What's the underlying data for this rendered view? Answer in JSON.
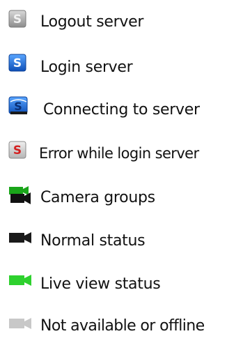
{
  "legend": {
    "items": [
      {
        "icon": "server-logout-icon",
        "label": "Logout server",
        "color": "#9a9a9a"
      },
      {
        "icon": "server-login-icon",
        "label": "Login server",
        "color": "#1c6fd6"
      },
      {
        "icon": "server-connecting-icon",
        "label": "Connecting to server",
        "color": "#1c6fd6"
      },
      {
        "icon": "server-error-icon",
        "label": "Error while login server",
        "color": "#d42020"
      },
      {
        "icon": "camera-groups-icon",
        "label": "Camera groups",
        "color": "#1aa51a"
      },
      {
        "icon": "camera-normal-icon",
        "label": "Normal status",
        "color": "#1a1a1a"
      },
      {
        "icon": "camera-live-icon",
        "label": "Live view status",
        "color": "#2ed12e"
      },
      {
        "icon": "camera-offline-icon",
        "label": "Not available or offline",
        "color": "#c8c8c8"
      }
    ]
  }
}
